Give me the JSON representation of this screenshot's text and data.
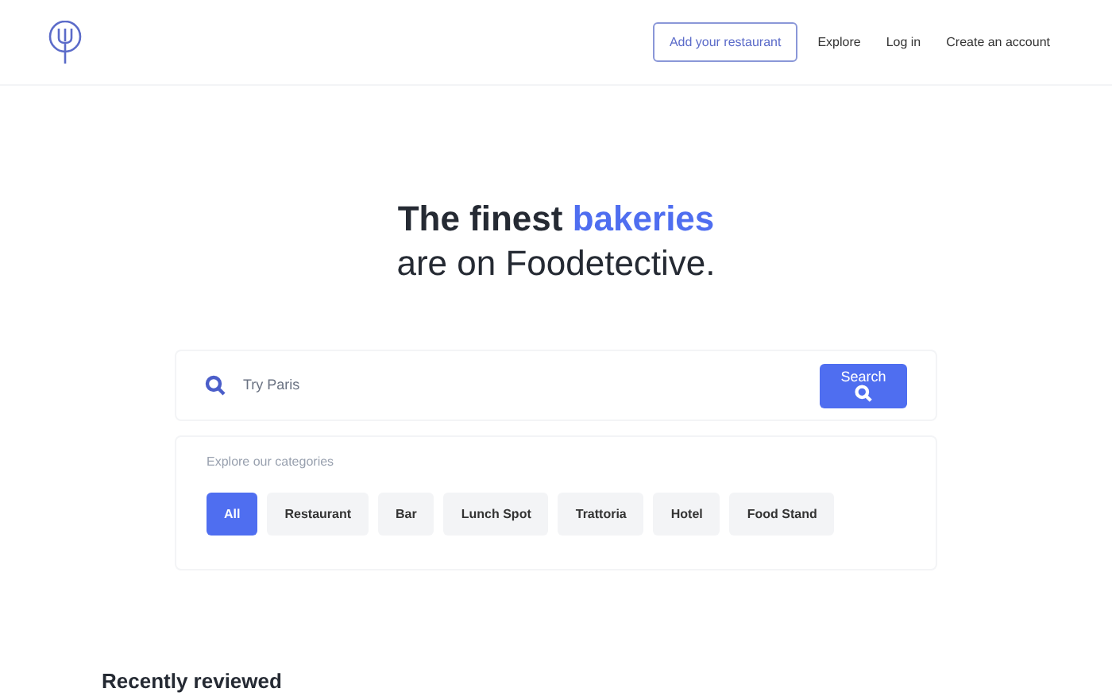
{
  "nav": {
    "links": [
      {
        "label": "Add your restaurant",
        "kind": "outlined"
      },
      {
        "label": "Explore",
        "kind": "plain"
      },
      {
        "label": "Log in",
        "kind": "plain"
      },
      {
        "label": "Create an account",
        "kind": "plain"
      }
    ]
  },
  "hero": {
    "title_start": "The finest",
    "title_highlight": "bakeries",
    "subtitle": "are on Foodetective."
  },
  "search": {
    "placeholder": "Try Paris",
    "button": "Search"
  },
  "categories": {
    "heading": "Explore our categories",
    "items": [
      {
        "label": "All",
        "selected": true
      },
      {
        "label": "Restaurant",
        "selected": false
      },
      {
        "label": "Bar",
        "selected": false
      },
      {
        "label": "Lunch Spot",
        "selected": false
      },
      {
        "label": "Trattoria",
        "selected": false
      },
      {
        "label": "Hotel",
        "selected": false
      },
      {
        "label": "Food Stand",
        "selected": false
      }
    ]
  },
  "section_title": "Recently reviewed"
}
